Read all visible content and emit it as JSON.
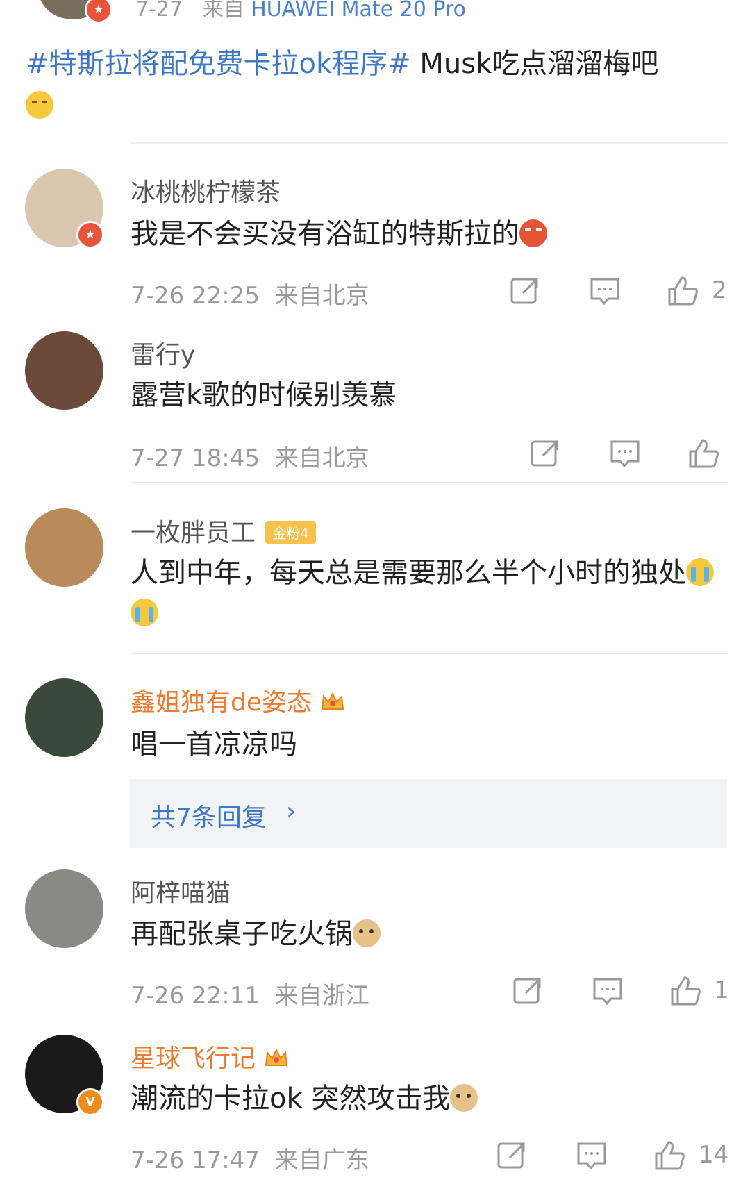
{
  "post": {
    "meta_date": "7-27",
    "meta_from": "来自",
    "meta_device": "HUAWEI Mate 20 Pro",
    "hashtag": "#特斯拉将配免费卡拉ok程序#",
    "text": " Musk吃点溜溜梅吧"
  },
  "comments": [
    {
      "name": "冰桃桃柠檬茶",
      "text": "我是不会买没有浴缸的特斯拉的",
      "time": "7-26 22:25",
      "location": "来自北京",
      "likes": "2",
      "avatar_color": "#d9c7b0",
      "badge_icon": "verified-icon"
    },
    {
      "name": "雷行y",
      "text": "露营k歌的时候别羡慕",
      "time": "7-27 18:45",
      "location": "来自北京",
      "likes": "",
      "avatar_color": "#6b4a3a",
      "badge_icon": ""
    },
    {
      "name": "一枚胖员工",
      "fan_badge": "金粉4",
      "text": "人到中年，每天总是需要那么半个小时的独处",
      "avatar_color": "#b98a5a"
    },
    {
      "name": "鑫姐独有de姿态",
      "text": "唱一首凉凉吗",
      "replies_label": "共7条回复",
      "avatar_color": "#3a4a3a"
    },
    {
      "name": "阿梓喵猫",
      "text": "再配张桌子吃火锅",
      "time": "7-26 22:11",
      "location": "来自浙江",
      "likes": "1",
      "avatar_color": "#8a8a85"
    },
    {
      "name": "星球飞行记",
      "text": "潮流的卡拉ok 突然攻击我",
      "time": "7-26 17:47",
      "location": "来自广东",
      "likes": "14",
      "avatar_color": "#1a1a1a",
      "badge_icon": "v-icon"
    }
  ],
  "colors": {
    "link": "#3f78c9",
    "vip_name": "#f07b2e",
    "meta": "#999999"
  }
}
